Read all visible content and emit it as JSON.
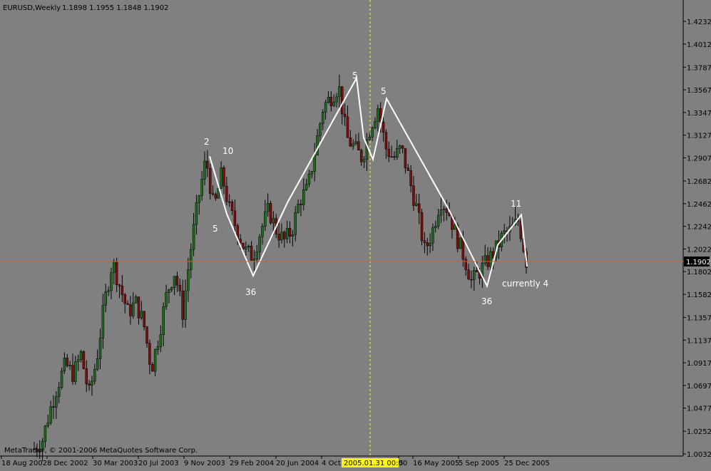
{
  "header": {
    "symbol": "EURUSD,Weekly",
    "ohlc": "1.1898 1.1955 1.1848 1.1902"
  },
  "copyright": "MetaTrader, © 2001-2006 MetaQuotes Software Corp.",
  "cursor_label": "2005.01.31 00:00",
  "colors": {
    "background": "#808080",
    "bull": "#1e6b1e",
    "bear": "#7a0f0f",
    "wick": "#000000",
    "pattern": "#ffffff",
    "price_line": "#e05a24",
    "cursor": "#ffff00"
  },
  "chart_data": {
    "type": "candlestick",
    "title": "EURUSD,Weekly",
    "grid": false,
    "ylim": [
      1.0032,
      1.4232
    ],
    "y_ticks": [
      "1.4232",
      "1.4012",
      "1.3787",
      "1.3567",
      "1.3347",
      "1.3127",
      "1.2907",
      "1.2682",
      "1.2462",
      "1.2242",
      "1.2022",
      "1.1802",
      "1.1582",
      "1.1357",
      "1.1137",
      "1.0917",
      "1.0697",
      "1.0477",
      "1.0252",
      "1.0032"
    ],
    "x_ticks": [
      "18 Aug 2002",
      "8 Dec 2002",
      "30 Mar 2003",
      "20 Jul 2003",
      "9 Nov 2003",
      "29 Feb 2004",
      "20 Jun 2004",
      "4 Oct 2004",
      "5",
      "16 May 2005",
      "5 Sep 2005",
      "25 Dec 2005"
    ],
    "current_price": "1.1902",
    "close_path": [
      1.0082,
      1.0152,
      1.0452,
      1.0702,
      1.0902,
      1.0802,
      1.1002,
      1.0602,
      1.0952,
      1.1502,
      1.1902,
      1.1652,
      1.1402,
      1.1502,
      1.1302,
      1.0852,
      1.1202,
      1.1602,
      1.1802,
      1.1402,
      1.2002,
      1.2502,
      1.2902,
      1.2402,
      1.2752,
      1.2402,
      1.2202,
      1.2002,
      1.1952,
      1.2202,
      1.2402,
      1.2202,
      1.2102,
      1.2202,
      1.2502,
      1.2602,
      1.3002,
      1.3402,
      1.3502,
      1.3602,
      1.3102,
      1.3002,
      1.2902,
      1.3202,
      1.3402,
      1.3002,
      1.2902,
      1.3002,
      1.2702,
      1.2402,
      1.2002,
      1.2202,
      1.2502,
      1.2402,
      1.2152,
      1.1952,
      1.1702,
      1.1802,
      1.1902,
      1.2002,
      1.2152,
      1.2202,
      1.2302,
      1.1902
    ],
    "pattern_line": [
      1.2922,
      1.2362,
      1.1762,
      1.2472,
      1.3682,
      1.3102,
      1.2892,
      1.3482,
      1.2422,
      1.1662,
      1.2062,
      1.2352,
      1.1852
    ],
    "annotations": [
      "2",
      "10",
      "5",
      "36",
      "5",
      "5",
      "11",
      "36",
      "currently 4"
    ]
  }
}
